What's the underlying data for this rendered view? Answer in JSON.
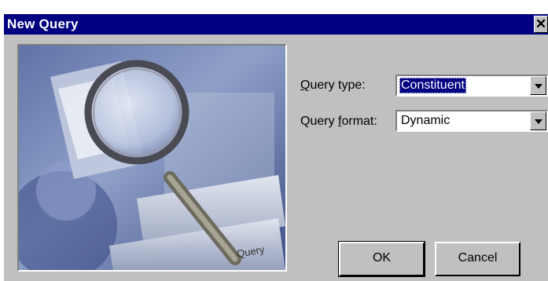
{
  "window": {
    "title": "New Query",
    "close_glyph": "✕"
  },
  "form": {
    "query_type": {
      "label": "Query type:",
      "accel": "Q",
      "value": "Constituent"
    },
    "query_format": {
      "label": "Query format:",
      "accel": "f",
      "value": "Dynamic"
    }
  },
  "buttons": {
    "ok": "OK",
    "cancel": "Cancel"
  },
  "picture": {
    "keycap_text": "Query"
  },
  "colors": {
    "titlebar": "#000080",
    "face": "#c0c0c0"
  }
}
